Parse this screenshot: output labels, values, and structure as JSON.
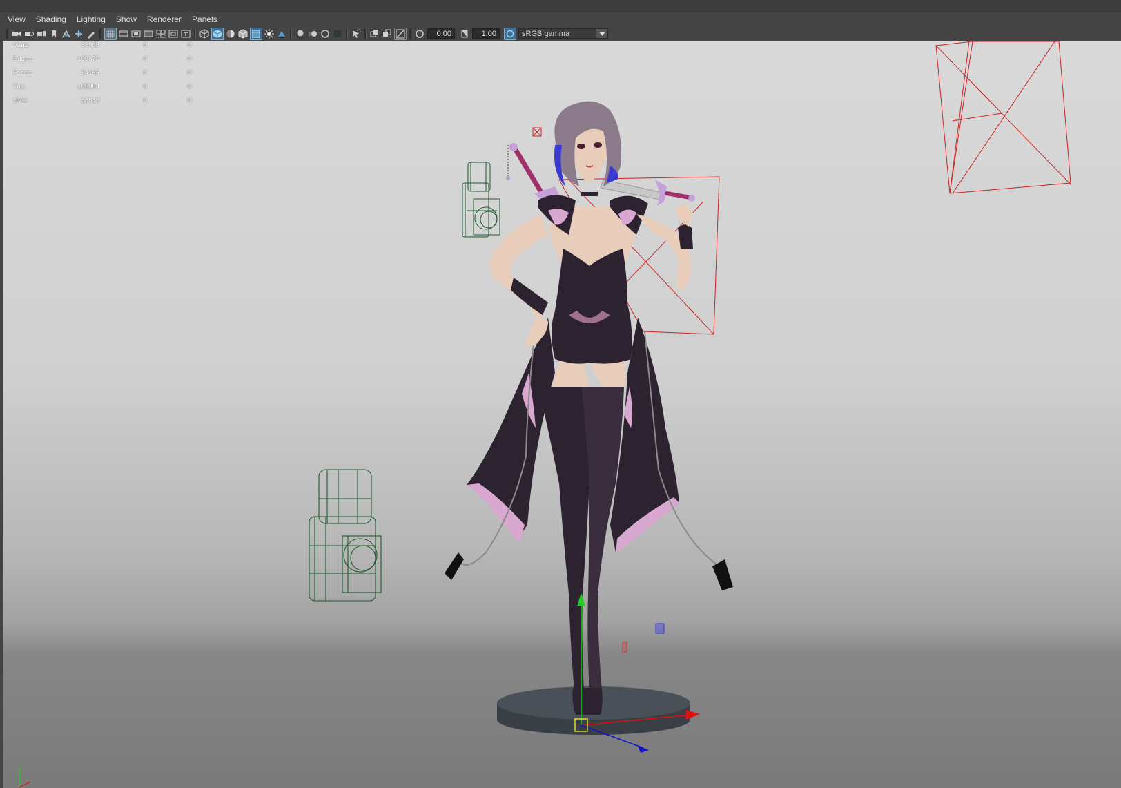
{
  "menubar": {
    "items": [
      "View",
      "Shading",
      "Lighting",
      "Show",
      "Renderer",
      "Panels"
    ]
  },
  "toolbar": {
    "exposure_value": "0.00",
    "gamma_value": "1.00",
    "color_space": "sRGB gamma",
    "icons": [
      "camera-icon",
      "camera-attributes-icon",
      "bookmark-icon",
      "image-plane-icon",
      "grid-icon",
      "film-gate-icon",
      "resolution-gate-icon",
      "wireframe-icon",
      "smooth-shade-icon",
      "textured-icon",
      "lights-icon",
      "shadows-icon",
      "xray-icon",
      "isolate-icon",
      "exposure-icon",
      "gamma-icon",
      "color-management-icon"
    ]
  },
  "hud": {
    "rows": [
      {
        "label": "Verts:",
        "v1": "55985",
        "v2": "0",
        "v3": "0"
      },
      {
        "label": "Edges:",
        "v1": "109879",
        "v2": "0",
        "v3": "0"
      },
      {
        "label": "Faces:",
        "v1": "54165",
        "v2": "0",
        "v3": "0"
      },
      {
        "label": "Tris:",
        "v1": "105904",
        "v2": "0",
        "v3": "0"
      },
      {
        "label": "UVs:",
        "v1": "58618",
        "v2": "0",
        "v3": "0"
      }
    ]
  },
  "colors": {
    "viewport_top": "#d9d9d9",
    "viewport_floor": "#7a7a7a",
    "light_wire": "#1e5a2e",
    "camera_wire": "#cc2222",
    "axis_y": "#22cc22",
    "axis_x": "#dd1111",
    "axis_z": "#1111cc",
    "cloth_dark": "#2d2230",
    "cloth_pink": "#d9a8d0"
  }
}
